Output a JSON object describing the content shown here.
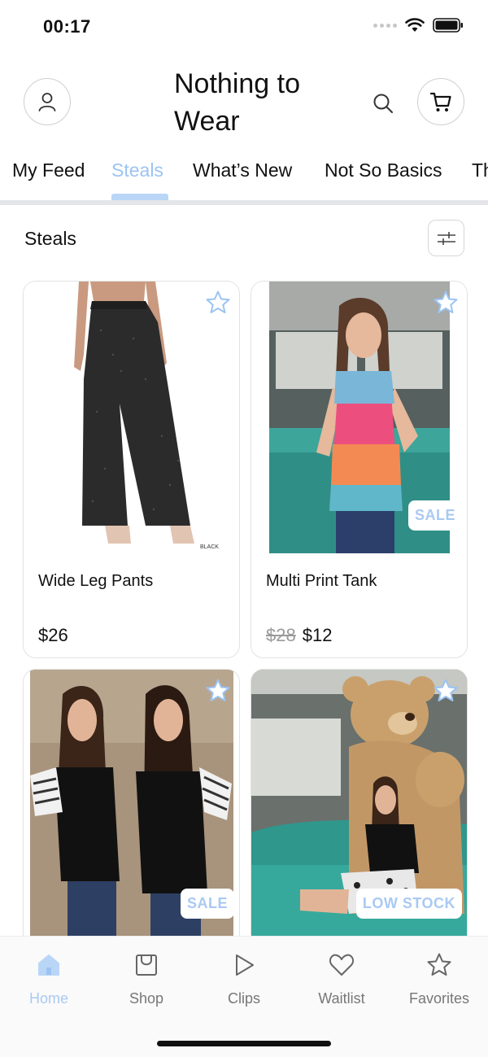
{
  "status_bar": {
    "time": "00:17"
  },
  "header": {
    "title": "Nothing to Wear"
  },
  "tabs": [
    {
      "label": "My Feed",
      "active": false
    },
    {
      "label": "Steals",
      "active": true
    },
    {
      "label": "What’s New",
      "active": false
    },
    {
      "label": "Not So Basics",
      "active": false
    },
    {
      "label": "Th",
      "active": false
    }
  ],
  "section": {
    "title": "Steals"
  },
  "products": [
    {
      "name": "Wide Leg Pants",
      "price": "$26",
      "old_price": "",
      "badge": "",
      "image_label": "BLACK"
    },
    {
      "name": "Multi Print Tank",
      "price": "$12",
      "old_price": "$28",
      "badge": "SALE",
      "image_label": ""
    },
    {
      "name": "",
      "price": "",
      "old_price": "",
      "badge": "SALE",
      "image_label": ""
    },
    {
      "name": "",
      "price": "",
      "old_price": "",
      "badge": "LOW STOCK",
      "image_label": ""
    }
  ],
  "bottom_nav": [
    {
      "label": "Home",
      "icon": "home-icon",
      "active": true
    },
    {
      "label": "Shop",
      "icon": "shopping-bag-icon",
      "active": false
    },
    {
      "label": "Clips",
      "icon": "play-icon",
      "active": false
    },
    {
      "label": "Waitlist",
      "icon": "heart-icon",
      "active": false
    },
    {
      "label": "Favorites",
      "icon": "star-icon",
      "active": false
    }
  ],
  "colors": {
    "accent": "#9cc3f3",
    "badge_text": "#a9c9f3",
    "divider": "#e4e5e8"
  }
}
